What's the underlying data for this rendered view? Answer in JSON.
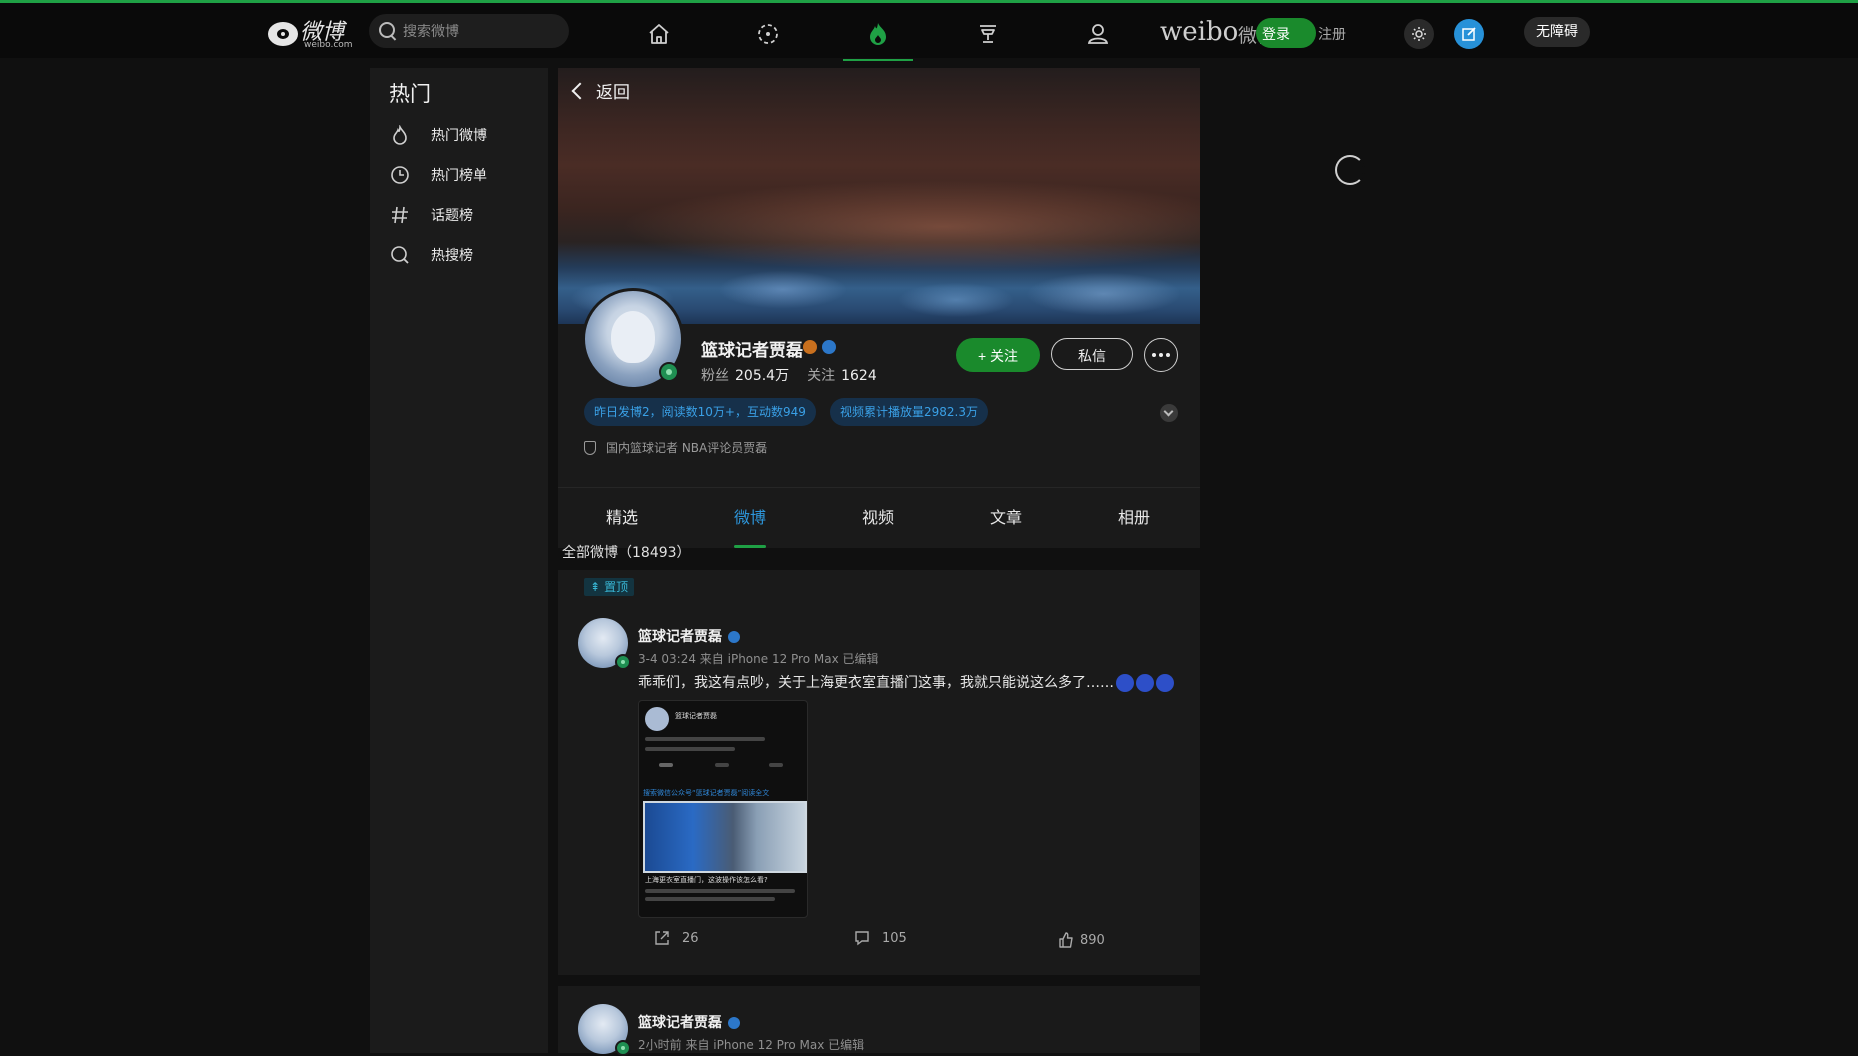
{
  "topbar": {
    "logo_text": "微博",
    "logo_sub": "weibo.com",
    "search_placeholder": "搜索微博",
    "nav_icons": [
      "home-icon",
      "video-icon",
      "hot-icon",
      "game-icon",
      "user-icon"
    ],
    "active_nav": "hot-icon",
    "weibo_wordmark": "weibo",
    "weibo_cn": "微博",
    "login_label": "登录",
    "register_label": "注册",
    "a11y_label": "无障碍",
    "accent_color": "#1fa045"
  },
  "sidebar": {
    "title": "热门",
    "items": [
      {
        "label": "热门微博",
        "icon": "flame-icon"
      },
      {
        "label": "热门榜单",
        "icon": "clock-icon"
      },
      {
        "label": "话题榜",
        "icon": "hashtag-icon"
      },
      {
        "label": "热搜榜",
        "icon": "search-hot-icon"
      }
    ]
  },
  "profile": {
    "back_label": "返回",
    "name": "篮球记者贾磊",
    "fans_label": "粉丝",
    "fans_value": "205.4万",
    "following_label": "关注",
    "following_value": "1624",
    "follow_button": "+ 关注",
    "message_button": "私信",
    "chips": [
      "昨日发博2，阅读数10万+，互动数949",
      "视频累计播放量2982.3万"
    ],
    "bio": "国内篮球记者 NBA评论员贾磊"
  },
  "tabs": [
    {
      "label": "精选"
    },
    {
      "label": "微博",
      "active": true
    },
    {
      "label": "视频"
    },
    {
      "label": "文章"
    },
    {
      "label": "相册"
    }
  ],
  "feed": {
    "count_label": "全部微博（18493）",
    "posts": [
      {
        "pinned_label": "置顶",
        "author": "篮球记者贾磊",
        "meta": "3-4 03:24  来自 iPhone 12 Pro Max 已编辑",
        "text": "乖乖们，我这有点吵，关于上海更衣室直播门这事，我就只能说这么多了……",
        "thumb": {
          "head": "篮球记者贾磊",
          "blue": "搜索微信公众号“篮球记者贾磊”阅读全文",
          "caption": "上海更衣室直播门，这波操作该怎么看?"
        },
        "reposts": "26",
        "comments": "105",
        "likes": "890"
      },
      {
        "author": "篮球记者贾磊",
        "meta": "2小时前  来自 iPhone 12 Pro Max 已编辑"
      }
    ]
  }
}
